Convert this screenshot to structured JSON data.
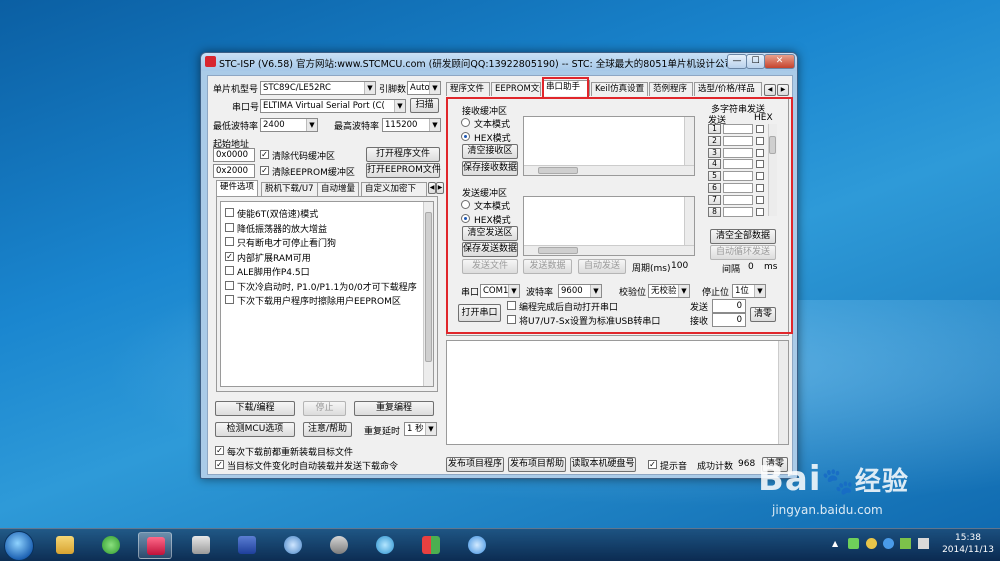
{
  "window": {
    "title": "STC-ISP (V6.58) 官方网站:www.STCMCU.com  (研发顾问QQ:13922805190)  -- STC: 全球最大的8051单片机设计公司 (既...",
    "min": "—",
    "max": "☐",
    "close": "✕"
  },
  "left": {
    "mcu_type_label": "单片机型号",
    "mcu_type_value": "STC89C/LE52RC",
    "pins_label": "引脚数",
    "pins_value": "Auto",
    "port_label": "串口号",
    "port_value": "ELTIMA Virtual Serial Port (C(",
    "scan_button": "扫描",
    "min_baud_label": "最低波特率",
    "min_baud_value": "2400",
    "max_baud_label": "最高波特率",
    "max_baud_value": "115200",
    "start_addr_label": "起始地址",
    "addr1": "0x0000",
    "clear_code_buffer": "清除代码缓冲区",
    "open_program_file": "打开程序文件",
    "addr2": "0x2000",
    "clear_eeprom_buffer": "清除EEPROM缓冲区",
    "open_eeprom_file": "打开EEPROM文件",
    "tabs": [
      "硬件选项",
      "脱机下载/U7",
      "自动增量",
      "自定义加密下"
    ],
    "options": [
      {
        "label": "使能6T(双倍速)模式",
        "checked": false
      },
      {
        "label": "降低振荡器的放大增益",
        "checked": false
      },
      {
        "label": "只有断电才可停止看门狗",
        "checked": false
      },
      {
        "label": "内部扩展RAM可用",
        "checked": true
      },
      {
        "label": "ALE脚用作P4.5口",
        "checked": false
      },
      {
        "label": "下次冷启动时, P1.0/P1.1为0/0才可下载程序",
        "checked": false
      },
      {
        "label": "下次下载用户程序时擦除用户EEPROM区",
        "checked": false
      }
    ],
    "download_button": "下载/编程",
    "stop_button": "停止",
    "reprogram_button": "重复编程",
    "check_mcu_button": "检测MCU选项",
    "help_button": "注意/帮助",
    "repeat_delay_label": "重复延时",
    "repeat_delay_value": "1 秒",
    "reload_each_time": "每次下载前都重新装载目标文件",
    "auto_reload": "当目标文件变化时自动装载并发送下载命令"
  },
  "right": {
    "tabs": [
      "程序文件",
      "EEPROM文件",
      "串口助手",
      "Keil仿真设置",
      "范例程序",
      "选型/价格/样品"
    ],
    "active_tab": "串口助手",
    "recv_group": "接收缓冲区",
    "text_mode": "文本模式",
    "hex_mode": "HEX模式",
    "clear_recv": "清空接收区",
    "save_recv": "保存接收数据",
    "send_group": "发送缓冲区",
    "clear_send": "清空发送区",
    "save_send": "保存发送数据",
    "send_file": "发送文件",
    "send_data": "发送数据",
    "auto_send": "自动发送",
    "period_label": "周期(ms)",
    "period_value": "100",
    "multi_title": "多字符串发送",
    "multi_send_col": "发送",
    "multi_hex_col": "HEX",
    "multi_rows": [
      "1",
      "2",
      "3",
      "4",
      "5",
      "6",
      "7",
      "8"
    ],
    "clear_all": "清空全部数据",
    "auto_cycle": "自动循环发送",
    "interval_label": "间隔",
    "interval_value": "0",
    "interval_unit": "ms",
    "serial_label": "串口",
    "serial_value": "COM10",
    "baud_label": "波特率",
    "baud_value": "9600",
    "parity_label": "校验位",
    "parity_value": "无校验",
    "stopbit_label": "停止位",
    "stopbit_value": "1位",
    "open_port": "打开串口",
    "auto_open": "编程完成后自动打开串口",
    "usb_setting": "将U7/U7-Sx设置为标准USB转串口",
    "send_count_label": "发送",
    "send_count": "0",
    "recv_count_label": "接收",
    "recv_count": "0",
    "clear_counts": "清零",
    "publish_program": "发布项目程序",
    "publish_help": "发布项目帮助",
    "read_disk": "读取本机硬盘号",
    "beep_label": "提示音",
    "success_label": "成功计数",
    "success_value": "968",
    "success_clear": "清零"
  },
  "taskbar": {
    "time": "15:38",
    "date": "2014/11/13"
  },
  "watermark": {
    "brand": "Bai",
    "brand2": "经验",
    "url": "jingyan.baidu.com"
  },
  "colors": {
    "highlight": "#e0262b",
    "accent": "#1d57b3"
  }
}
